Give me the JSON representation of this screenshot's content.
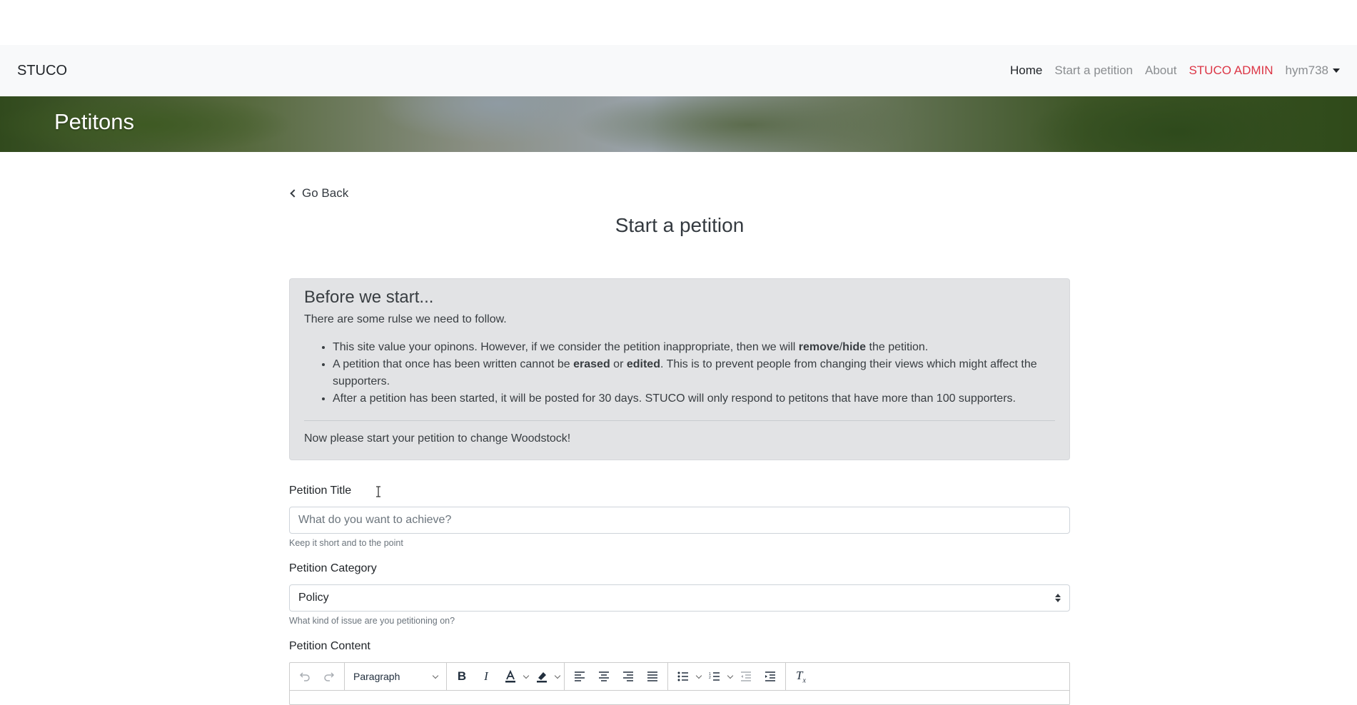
{
  "navbar": {
    "brand": "STUCO",
    "links": {
      "home": "Home",
      "start": "Start a petition",
      "about": "About",
      "admin": "STUCO ADMIN",
      "user": "hym738"
    }
  },
  "hero": {
    "title": "Petitons"
  },
  "page": {
    "go_back": "Go Back",
    "title": "Start a petition"
  },
  "notice": {
    "heading": "Before we start...",
    "intro": "There are some rulse we need to follow.",
    "rule1_a": "This site value your opinons. However, if we consider the petition inappropriate, then we will ",
    "rule1_b": "remove",
    "rule1_c": "/",
    "rule1_d": "hide",
    "rule1_e": " the petition.",
    "rule2_a": "A petition that once has been written cannot be ",
    "rule2_b": "erased",
    "rule2_c": " or ",
    "rule2_d": "edited",
    "rule2_e": ". This is to prevent people from changing their views which might affect the supporters.",
    "rule3": "After a petition has been started, it will be posted for 30 days. STUCO will only respond to petitons that have more than 100 supporters.",
    "cta": "Now please start your petition to change Woodstock!"
  },
  "form": {
    "title_label": "Petition Title",
    "title_placeholder": "What do you want to achieve?",
    "title_help": "Keep it short and to the point",
    "category_label": "Petition Category",
    "category_value": "Policy",
    "category_help": "What kind of issue are you petitioning on?",
    "content_label": "Petition Content"
  },
  "editor": {
    "format_value": "Paragraph",
    "icons": [
      "undo-icon",
      "redo-icon",
      "bold-icon",
      "italic-icon",
      "text-color-icon",
      "highlight-icon",
      "align-left-icon",
      "align-center-icon",
      "align-right-icon",
      "justify-icon",
      "bullet-list-icon",
      "numbered-list-icon",
      "outdent-icon",
      "indent-icon",
      "clear-format-icon"
    ]
  }
}
